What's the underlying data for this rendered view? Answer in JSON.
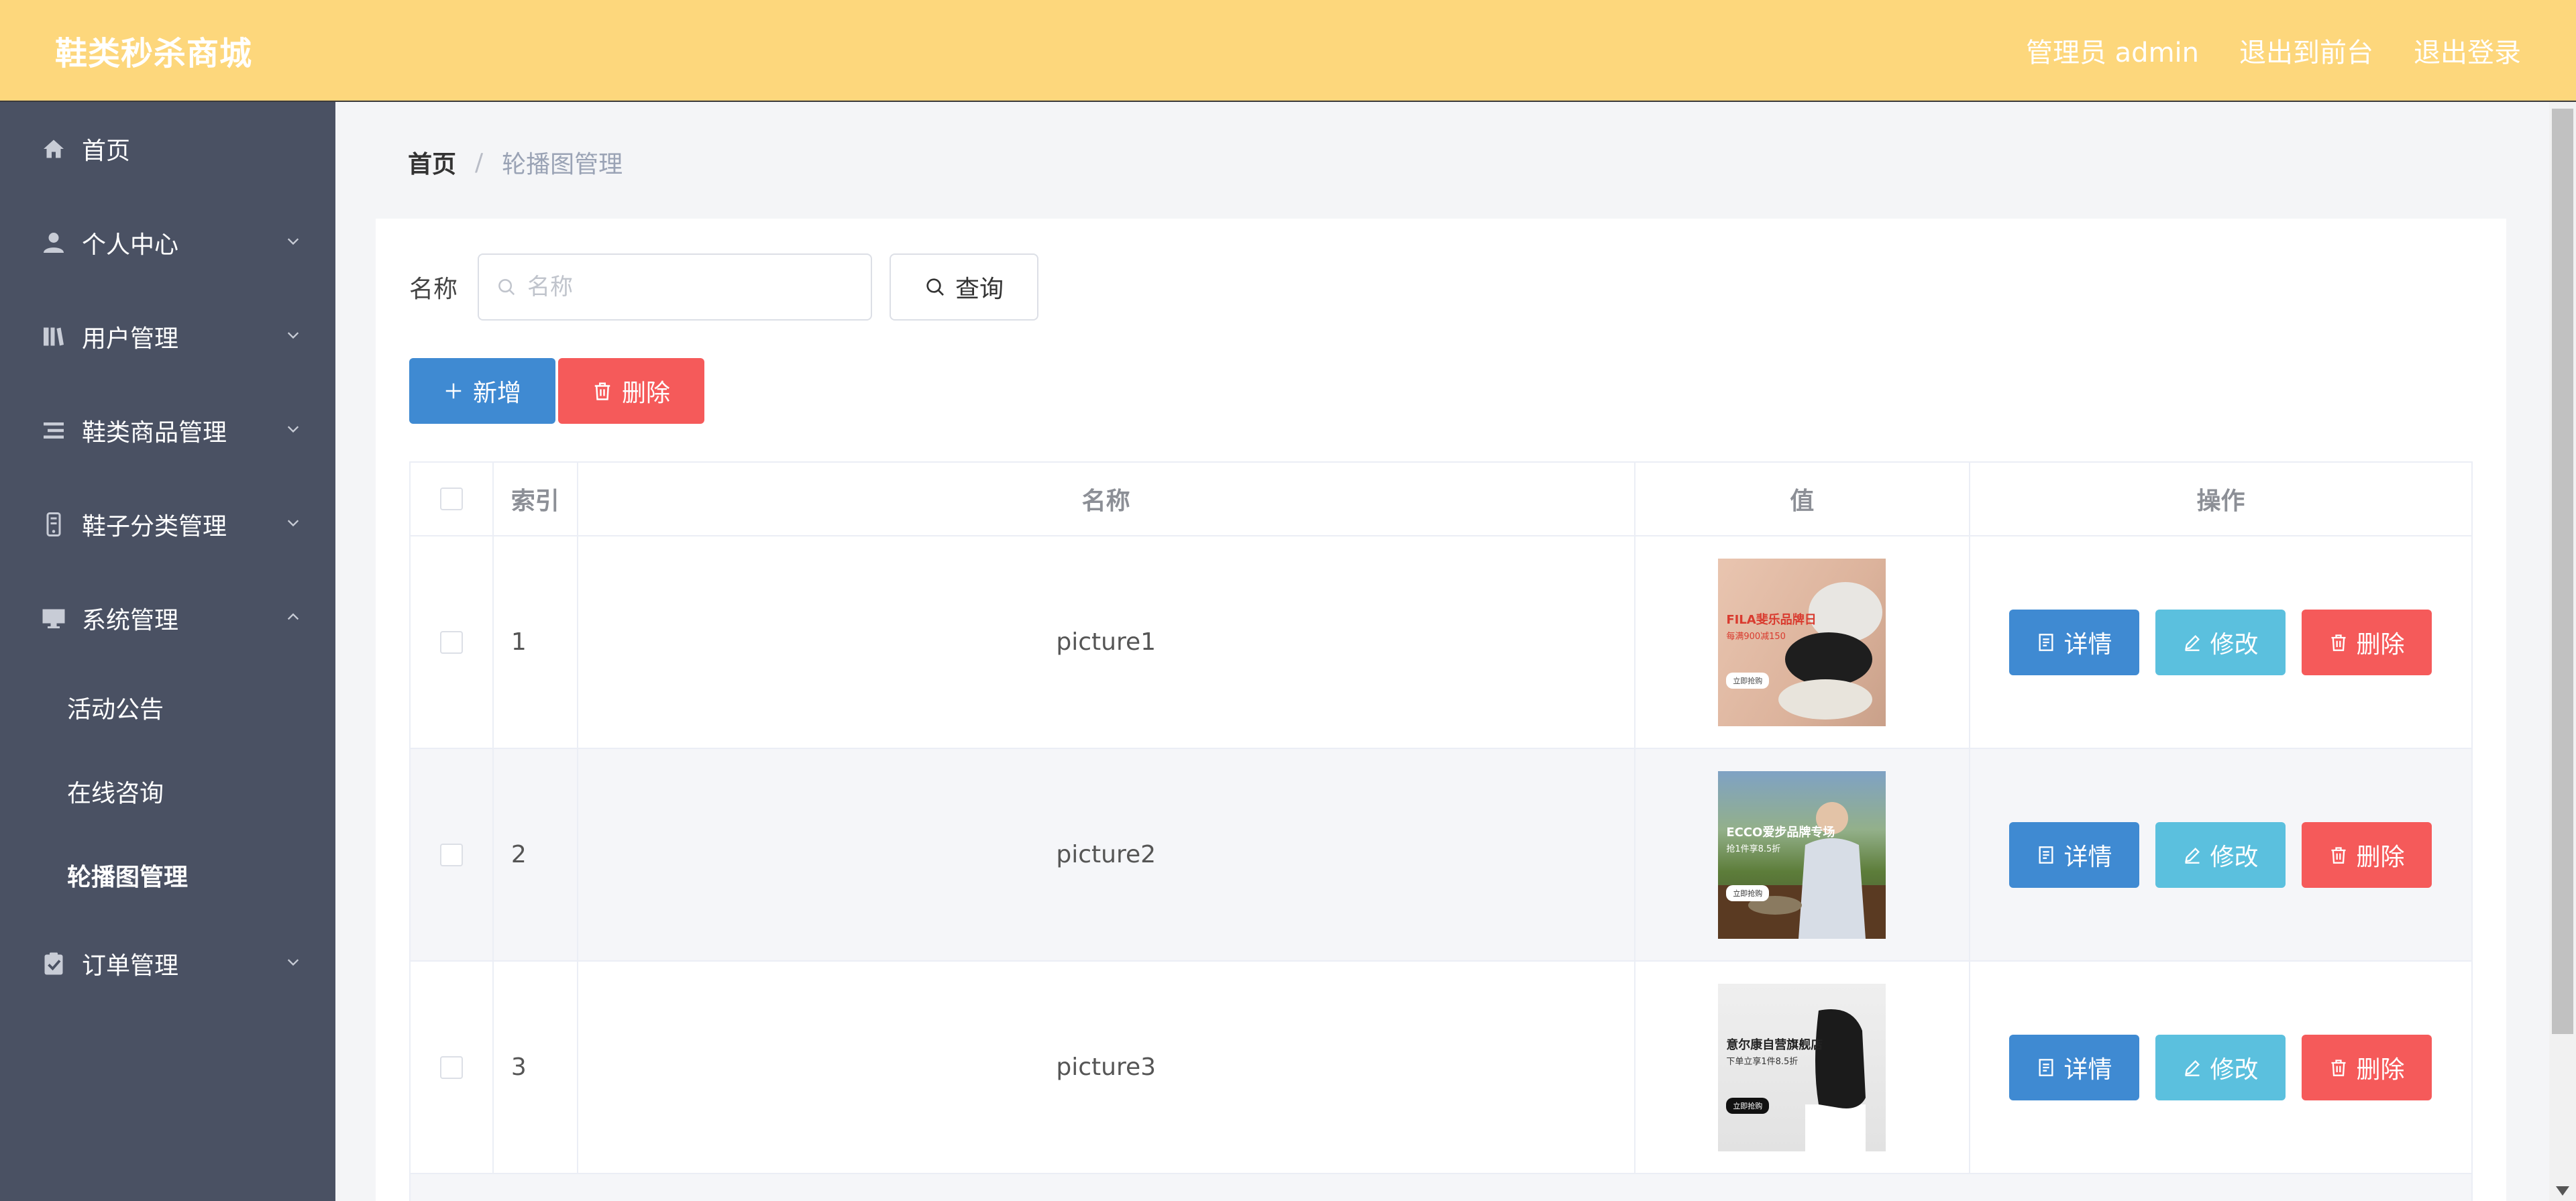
{
  "header": {
    "brand": "鞋类秒杀商城",
    "admin_label": "管理员 admin",
    "to_front": "退出到前台",
    "logout": "退出登录",
    "bg_color": "#fdd77c"
  },
  "sidebar": {
    "bg_color": "#4a5163",
    "items": [
      {
        "label": "首页",
        "icon": "home-icon",
        "expanded": false
      },
      {
        "label": "个人中心",
        "icon": "user-icon",
        "expanded": false
      },
      {
        "label": "用户管理",
        "icon": "book-icon",
        "expanded": false
      },
      {
        "label": "鞋类商品管理",
        "icon": "list-icon",
        "expanded": false
      },
      {
        "label": "鞋子分类管理",
        "icon": "mobile-icon",
        "expanded": false
      },
      {
        "label": "系统管理",
        "icon": "monitor-icon",
        "expanded": true
      },
      {
        "label": "订单管理",
        "icon": "clipboard-icon",
        "expanded": false
      }
    ],
    "submenu": [
      {
        "label": "活动公告"
      },
      {
        "label": "在线咨询"
      },
      {
        "label": "轮播图管理",
        "active": true
      }
    ]
  },
  "breadcrumb": {
    "home": "首页",
    "separator": "/",
    "current": "轮播图管理"
  },
  "search": {
    "label": "名称",
    "placeholder": "名称",
    "value": "",
    "query_button": "查询"
  },
  "actions": {
    "add": "新增",
    "delete": "删除",
    "add_color": "#3f8ad2",
    "delete_color": "#f55a5a"
  },
  "table": {
    "columns": [
      "索引",
      "名称",
      "值",
      "操作"
    ],
    "rows": [
      {
        "index": "1",
        "name": "picture1",
        "thumb_title": "FILA斐乐品牌日",
        "thumb_sub": "每满900减150",
        "thumb_btn": "立即抢购"
      },
      {
        "index": "2",
        "name": "picture2",
        "thumb_title": "ECCO爱步品牌专场",
        "thumb_sub": "抢1件享8.5折",
        "thumb_btn": "立即抢购"
      },
      {
        "index": "3",
        "name": "picture3",
        "thumb_title": "意尔康自营旗舰店",
        "thumb_sub": "下单立享1件8.5折",
        "thumb_btn": "立即抢购"
      }
    ],
    "ops": {
      "detail": "详情",
      "edit": "修改",
      "remove": "删除"
    }
  }
}
